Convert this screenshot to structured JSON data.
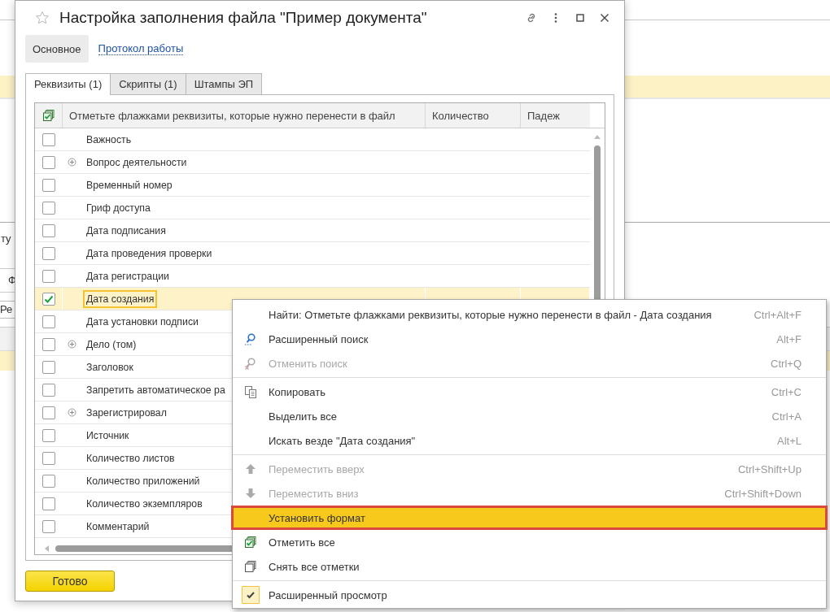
{
  "background_window": {
    "texts": [
      {
        "kind": "label",
        "text": "ту"
      },
      {
        "kind": "tab",
        "text": "Ф"
      },
      {
        "kind": "field",
        "text": "Ре"
      }
    ]
  },
  "window": {
    "title": "Настройка заполнения файла \"Пример документа\"",
    "favorite": false
  },
  "toolbar": [
    {
      "kind": "button",
      "label": "Основное",
      "selected": true
    },
    {
      "kind": "link",
      "label": "Протокол работы",
      "selected": false
    }
  ],
  "tabs": [
    {
      "label": "Реквизиты (1)",
      "selected": true
    },
    {
      "label": "Скрипты (1)",
      "selected": false
    },
    {
      "label": "Штампы ЭП",
      "selected": false
    }
  ],
  "table": {
    "columns": [
      "Отметьте флажками реквизиты, которые нужно перенести в файл",
      "Количество",
      "Падеж"
    ],
    "rows": [
      {
        "name": "Важность",
        "checked": false,
        "expandable": false,
        "selected": false
      },
      {
        "name": "Вопрос деятельности",
        "checked": false,
        "expandable": true,
        "selected": false
      },
      {
        "name": "Временный номер",
        "checked": false,
        "expandable": false,
        "selected": false
      },
      {
        "name": "Гриф доступа",
        "checked": false,
        "expandable": false,
        "selected": false
      },
      {
        "name": "Дата подписания",
        "checked": false,
        "expandable": false,
        "selected": false
      },
      {
        "name": "Дата проведения проверки",
        "checked": false,
        "expandable": false,
        "selected": false
      },
      {
        "name": "Дата регистрации",
        "checked": false,
        "expandable": false,
        "selected": false
      },
      {
        "name": "Дата создания",
        "checked": true,
        "expandable": false,
        "selected": true
      },
      {
        "name": "Дата установки подписи",
        "checked": false,
        "expandable": false,
        "selected": false
      },
      {
        "name": "Дело (том)",
        "checked": false,
        "expandable": true,
        "selected": false
      },
      {
        "name": "Заголовок",
        "checked": false,
        "expandable": false,
        "selected": false
      },
      {
        "name": "Запретить автоматическое ра",
        "checked": false,
        "expandable": false,
        "selected": false
      },
      {
        "name": "Зарегистрировал",
        "checked": false,
        "expandable": true,
        "selected": false
      },
      {
        "name": "Источник",
        "checked": false,
        "expandable": false,
        "selected": false
      },
      {
        "name": "Количество листов",
        "checked": false,
        "expandable": false,
        "selected": false
      },
      {
        "name": "Количество приложений",
        "checked": false,
        "expandable": false,
        "selected": false
      },
      {
        "name": "Количество экземпляров",
        "checked": false,
        "expandable": false,
        "selected": false
      },
      {
        "name": "Комментарий",
        "checked": false,
        "expandable": false,
        "selected": false
      }
    ]
  },
  "done_button": "Готово",
  "context_menu": {
    "groups": [
      [
        {
          "kind": "plain",
          "label": "Найти: Отметьте флажками реквизиты, которые нужно перенести в файл - Дата создания",
          "shortcut": "Ctrl+Alt+F",
          "disabled": false,
          "selected": false
        },
        {
          "kind": "search",
          "label": "Расширенный поиск",
          "shortcut": "Alt+F",
          "disabled": false,
          "selected": false
        },
        {
          "kind": "cancel_search",
          "label": "Отменить поиск",
          "shortcut": "Ctrl+Q",
          "disabled": true,
          "selected": false
        }
      ],
      [
        {
          "kind": "copy",
          "label": "Копировать",
          "shortcut": "Ctrl+C",
          "disabled": false,
          "selected": false
        },
        {
          "kind": "plain",
          "label": "Выделить все",
          "shortcut": "Ctrl+A",
          "disabled": false,
          "selected": false
        },
        {
          "kind": "plain",
          "label": "Искать везде \"Дата создания\"",
          "shortcut": "Alt+L",
          "disabled": false,
          "selected": false
        }
      ],
      [
        {
          "kind": "move_up",
          "label": "Переместить вверх",
          "shortcut": "Ctrl+Shift+Up",
          "disabled": true,
          "selected": false
        },
        {
          "kind": "move_down",
          "label": "Переместить вниз",
          "shortcut": "Ctrl+Shift+Down",
          "disabled": true,
          "selected": false
        },
        {
          "kind": "plain",
          "label": "Установить формат",
          "disabled": false,
          "selected": true
        },
        {
          "kind": "check_all",
          "label": "Отметить все",
          "disabled": false,
          "selected": false
        },
        {
          "kind": "uncheck_all",
          "label": "Снять все отметки",
          "disabled": false,
          "selected": false
        }
      ],
      [
        {
          "kind": "toggle",
          "label": "Расширенный просмотр",
          "disabled": false,
          "selected": false,
          "checked": true
        }
      ]
    ]
  }
}
